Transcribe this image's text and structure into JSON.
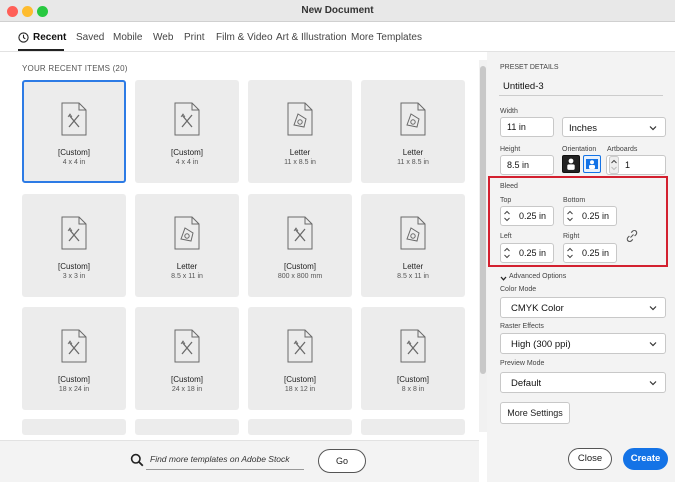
{
  "window": {
    "title": "New Document"
  },
  "tabs": [
    {
      "label": "Recent",
      "active": true
    },
    {
      "label": "Saved"
    },
    {
      "label": "Mobile"
    },
    {
      "label": "Web"
    },
    {
      "label": "Print"
    },
    {
      "label": "Film & Video"
    },
    {
      "label": "Art & Illustration"
    },
    {
      "label": "More Templates"
    }
  ],
  "recent": {
    "header": "YOUR RECENT ITEMS  (20)",
    "items": [
      {
        "name": "[Custom]",
        "size": "4 x 4 in",
        "icon": "custom-doc-icon",
        "selected": true
      },
      {
        "name": "[Custom]",
        "size": "4 x 4 in",
        "icon": "custom-doc-icon"
      },
      {
        "name": "Letter",
        "size": "11 x 8.5 in",
        "icon": "letter-doc-icon"
      },
      {
        "name": "Letter",
        "size": "11 x 8.5 in",
        "icon": "letter-doc-icon"
      },
      {
        "name": "[Custom]",
        "size": "3 x 3 in",
        "icon": "custom-doc-icon"
      },
      {
        "name": "Letter",
        "size": "8.5 x 11 in",
        "icon": "letter-doc-icon"
      },
      {
        "name": "[Custom]",
        "size": "800 x 800 mm",
        "icon": "custom-doc-icon"
      },
      {
        "name": "Letter",
        "size": "8.5 x 11 in",
        "icon": "letter-doc-icon"
      },
      {
        "name": "[Custom]",
        "size": "18 x 24 in",
        "icon": "custom-doc-icon"
      },
      {
        "name": "[Custom]",
        "size": "24 x 18 in",
        "icon": "custom-doc-icon"
      },
      {
        "name": "[Custom]",
        "size": "18 x 12 in",
        "icon": "custom-doc-icon"
      },
      {
        "name": "[Custom]",
        "size": "8 x 8 in",
        "icon": "custom-doc-icon"
      }
    ]
  },
  "search": {
    "placeholder": "Find more templates on Adobe Stock",
    "go_label": "Go"
  },
  "preset": {
    "header": "PRESET DETAILS",
    "name": "Untitled-3",
    "width_label": "Width",
    "width_value": "11 in",
    "units_value": "Inches",
    "height_label": "Height",
    "height_value": "8.5 in",
    "orientation_label": "Orientation",
    "artboards_label": "Artboards",
    "artboards_value": "1",
    "bleed": {
      "label": "Bleed",
      "top_label": "Top",
      "top_value": "0.25 in",
      "bottom_label": "Bottom",
      "bottom_value": "0.25 in",
      "left_label": "Left",
      "left_value": "0.25 in",
      "right_label": "Right",
      "right_value": "0.25 in",
      "highlight_color": "#d3202f"
    },
    "advanced_label": "Advanced Options",
    "color_mode_label": "Color Mode",
    "color_mode_value": "CMYK Color",
    "raster_label": "Raster Effects",
    "raster_value": "High (300 ppi)",
    "preview_label": "Preview Mode",
    "preview_value": "Default",
    "more_settings": "More Settings"
  },
  "actions": {
    "close": "Close",
    "create": "Create",
    "accent": "#1473e6"
  }
}
